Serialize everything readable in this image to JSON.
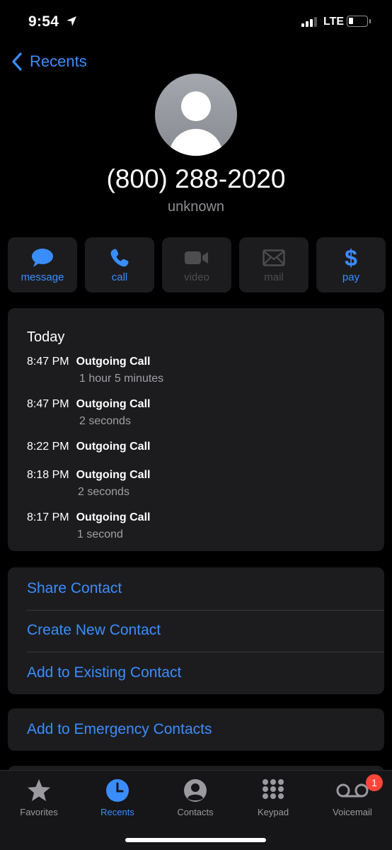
{
  "status_bar": {
    "time": "9:54",
    "carrier": "LTE"
  },
  "nav": {
    "back_label": "Recents"
  },
  "contact": {
    "number": "(800) 288-2020",
    "label": "unknown"
  },
  "actions": [
    {
      "label": "message",
      "icon": "message-bubble-icon",
      "enabled": true
    },
    {
      "label": "call",
      "icon": "phone-icon",
      "enabled": true
    },
    {
      "label": "video",
      "icon": "video-camera-icon",
      "enabled": false
    },
    {
      "label": "mail",
      "icon": "envelope-icon",
      "enabled": false
    },
    {
      "label": "pay",
      "icon": "dollar-icon",
      "enabled": true
    }
  ],
  "history": {
    "heading": "Today",
    "calls": [
      {
        "time": "8:47 PM",
        "type": "Outgoing Call",
        "duration": "1 hour 5 minutes"
      },
      {
        "time": "8:47 PM",
        "type": "Outgoing Call",
        "duration": "2 seconds"
      },
      {
        "time": "8:22 PM",
        "type": "Outgoing Call",
        "duration": ""
      },
      {
        "time": "8:18 PM",
        "type": "Outgoing Call",
        "duration": "2 seconds"
      },
      {
        "time": "8:17 PM",
        "type": "Outgoing Call",
        "duration": "1 second"
      }
    ]
  },
  "contact_actions": {
    "share": "Share Contact",
    "create": "Create New Contact",
    "add_existing": "Add to Existing Contact",
    "emergency": "Add to Emergency Contacts"
  },
  "tabbar": {
    "tabs": [
      {
        "label": "Favorites",
        "icon": "star-icon",
        "active": false
      },
      {
        "label": "Recents",
        "icon": "clock-icon",
        "active": true
      },
      {
        "label": "Contacts",
        "icon": "person-circle-icon",
        "active": false
      },
      {
        "label": "Keypad",
        "icon": "keypad-icon",
        "active": false
      },
      {
        "label": "Voicemail",
        "icon": "voicemail-icon",
        "active": false
      }
    ],
    "voicemail_badge": "1"
  },
  "colors": {
    "accent": "#3a8dff",
    "card": "#1c1c1e",
    "badge": "#ff453a"
  }
}
